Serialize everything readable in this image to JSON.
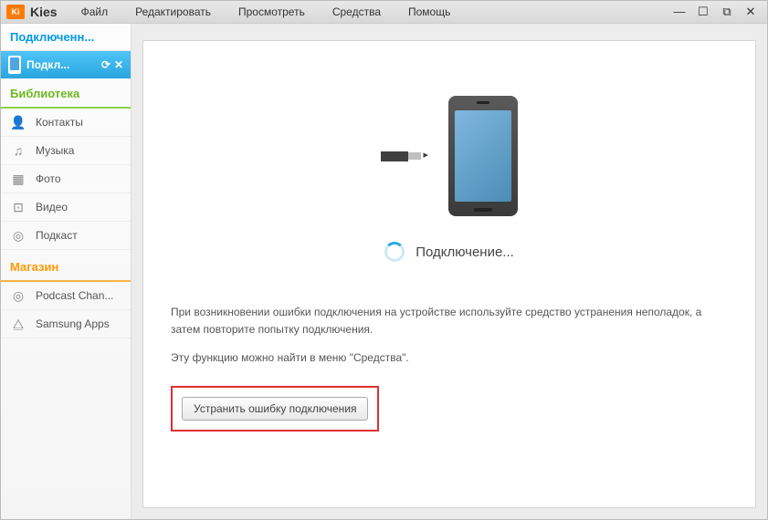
{
  "app": {
    "title": "Kies",
    "icon_text": "Ki"
  },
  "menu": {
    "file": "Файл",
    "edit": "Редактировать",
    "view": "Просмотреть",
    "tools": "Средства",
    "help": "Помощь"
  },
  "sidebar": {
    "connected_header": "Подключенн...",
    "device": {
      "label": "Подкл..."
    },
    "library_header": "Библиотека",
    "library": [
      {
        "label": "Контакты",
        "icon": "👤"
      },
      {
        "label": "Музыка",
        "icon": "♫"
      },
      {
        "label": "Фото",
        "icon": "▦"
      },
      {
        "label": "Видео",
        "icon": "⊡"
      },
      {
        "label": "Подкаст",
        "icon": "◎"
      }
    ],
    "store_header": "Магазин",
    "store": [
      {
        "label": "Podcast Chan...",
        "icon": "◎"
      },
      {
        "label": "Samsung Apps",
        "icon": "⧋"
      }
    ]
  },
  "main": {
    "status": "Подключение...",
    "msg1": "При возникновении ошибки подключения на устройстве используйте средство устранения неполадок, а затем повторите попытку подключения.",
    "msg2": "Эту функцию можно найти в меню \"Средства\".",
    "fix_button": "Устранить ошибку подключения"
  }
}
